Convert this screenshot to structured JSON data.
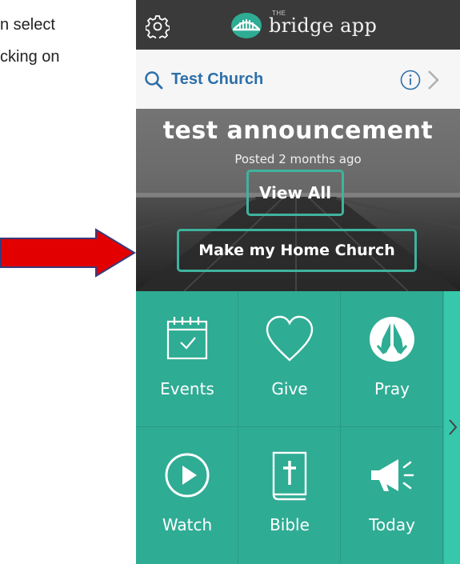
{
  "document": {
    "line1": "n select",
    "line2": "cking on"
  },
  "header": {
    "logo_small": "THE",
    "logo_text": "bridge app"
  },
  "church": {
    "name": "Test Church"
  },
  "announcement": {
    "title": "test announcement",
    "posted": "Posted 2 months ago",
    "view_all": "View All",
    "make_home": "Make my Home Church"
  },
  "tiles": [
    {
      "label": "Events",
      "icon": "calendar-icon"
    },
    {
      "label": "Give",
      "icon": "heart-icon"
    },
    {
      "label": "Pray",
      "icon": "praying-hands-icon"
    },
    {
      "label": "Watch",
      "icon": "play-icon"
    },
    {
      "label": "Bible",
      "icon": "bible-icon"
    },
    {
      "label": "Today",
      "icon": "megaphone-icon"
    }
  ],
  "colors": {
    "header_bg": "#3a3a3a",
    "accent_teal": "#2fac94",
    "button_border": "#3fb39d",
    "church_blue": "#2c6fa9",
    "arrow_red": "#e30000"
  }
}
